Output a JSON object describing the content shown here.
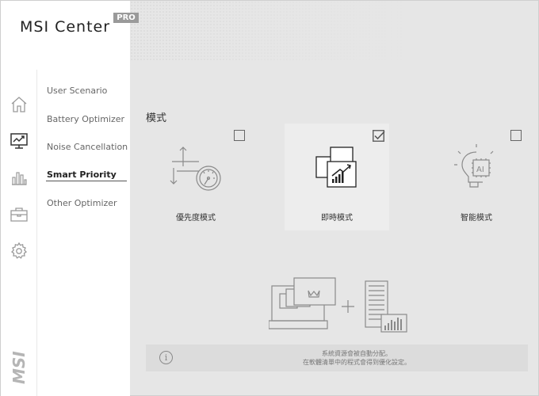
{
  "app": {
    "brand": "MSI Center",
    "badge": "PRO",
    "vertical_logo": "MSI"
  },
  "rail": {
    "icons": [
      "home-icon",
      "monitor-chart-icon",
      "bar-chart-icon",
      "toolbox-icon",
      "gear-icon"
    ],
    "active_icon": "monitor-chart-icon"
  },
  "submenu": {
    "items": [
      {
        "label": "User Scenario"
      },
      {
        "label": "Battery Optimizer"
      },
      {
        "label": "Noise Cancellation"
      },
      {
        "label": "Smart Priority"
      },
      {
        "label": "Other Optimizer"
      }
    ],
    "active_index": 3
  },
  "main": {
    "section_title": "模式",
    "modes": [
      {
        "label": "優先度模式",
        "checked": false,
        "icon": "priority-gauge-icon"
      },
      {
        "label": "即時模式",
        "checked": true,
        "icon": "realtime-windows-icon"
      },
      {
        "label": "智能模式",
        "checked": false,
        "icon": "ai-bulb-icon"
      }
    ],
    "illustration": "laptop-plus-apps-illustration",
    "info": {
      "line1": "系統資源會被自動分配。",
      "line2": "在軟體清單中的程式會得到優化設定。"
    }
  },
  "colors": {
    "background": "#e6e6e6",
    "panel": "#ffffff",
    "selected_card": "#ededed",
    "info_bar": "#dcdcdc"
  }
}
